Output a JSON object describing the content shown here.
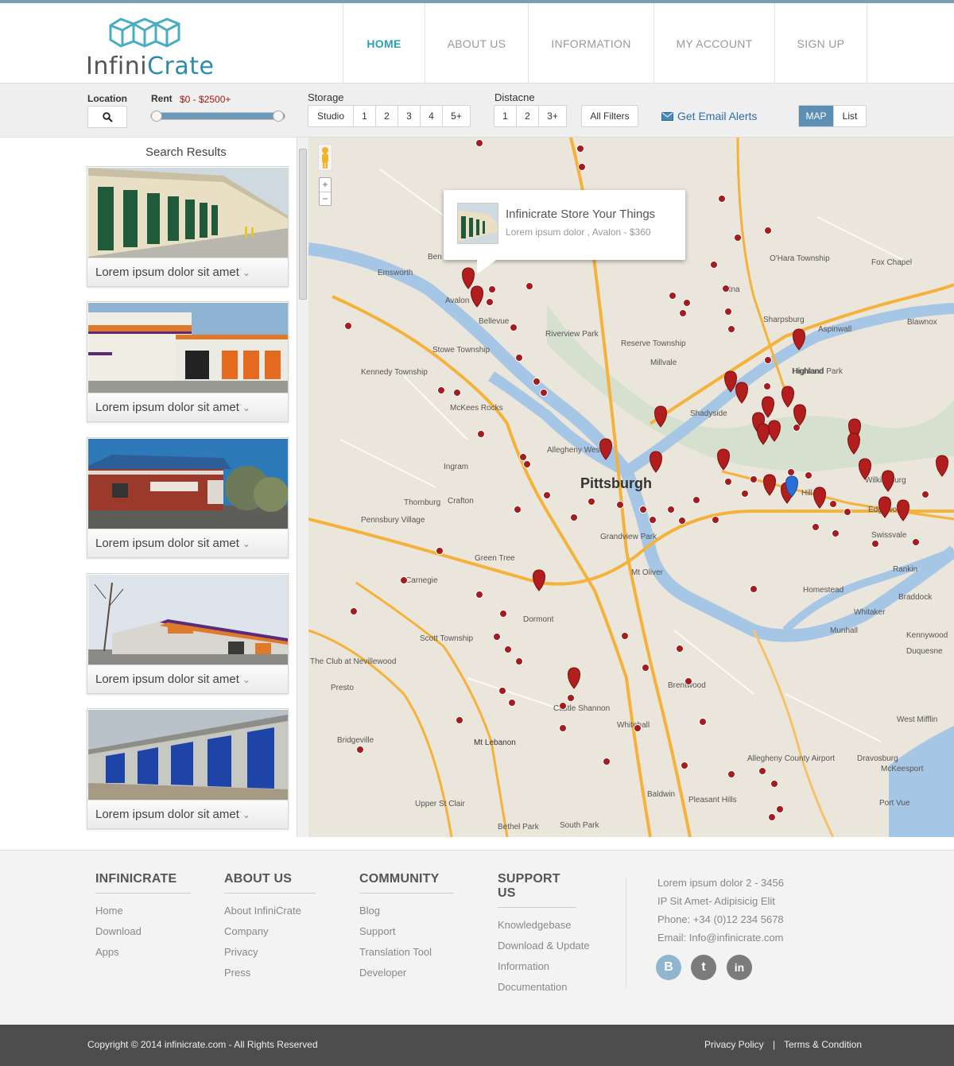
{
  "brand": {
    "name_part1": "Infini",
    "name_part2": "Crate"
  },
  "nav": [
    {
      "label": "HOME",
      "active": true
    },
    {
      "label": "ABOUT US"
    },
    {
      "label": "INFORMATION"
    },
    {
      "label": "MY ACCOUNT"
    },
    {
      "label": "SIGN UP"
    }
  ],
  "filters": {
    "location_label": "Location",
    "rent_label": "Rent",
    "rent_range": "$0  -  $2500+",
    "storage_label": "Storage",
    "storage_options": [
      "Studio",
      "1",
      "2",
      "3",
      "4",
      "5+"
    ],
    "distance_label": "Distacne",
    "distance_options": [
      "1",
      "2",
      "3+"
    ],
    "all_filters": "All Filters",
    "email_alerts": "Get Email Alerts",
    "view_map": "MAP",
    "view_list": "List",
    "search_icon": "search-icon",
    "mail_icon": "mail-icon"
  },
  "results": {
    "heading": "Search Results",
    "items": [
      {
        "caption": "Lorem ipsum dolor sit amet"
      },
      {
        "caption": "Lorem ipsum dolor sit amet"
      },
      {
        "caption": "Lorem ipsum dolor sit amet"
      },
      {
        "caption": "Lorem ipsum dolor sit amet"
      },
      {
        "caption": "Lorem ipsum dolor sit amet"
      }
    ]
  },
  "map": {
    "popup_title": "Infinicrate Store Your Things",
    "popup_subtitle": "Lorem ipsum dolor , Avalon - $360",
    "zoom_in": "+",
    "zoom_out": "−",
    "city_label": "Pittsburgh",
    "labels": [
      "Ben Avon Heights",
      "Emsworth",
      "Avalon",
      "Bellevue",
      "Stowe Township",
      "Kennedy Township",
      "McKees Rocks",
      "Ingram",
      "Crafton",
      "Thornburg",
      "Pennsbury Village",
      "Green Tree",
      "Carnegie",
      "Scott Township",
      "The Club at Nevillewood",
      "Presto",
      "Bridgeville",
      "Upper St Clair",
      "Mt Lebanon",
      "Castle Shannon",
      "Dormont",
      "Mt Oliver",
      "Brentwood",
      "Whitehall",
      "Baldwin",
      "Pleasant Hills",
      "Bethel Park",
      "South Park",
      "Riverview Park",
      "Reserve Township",
      "Millvale",
      "Etna",
      "Sharpsburg",
      "Aspinwall",
      "O'Hara Township",
      "Fox Chapel",
      "Blawnox",
      "Highland Park",
      "Grandview Park",
      "Homestead",
      "Munhall",
      "Whitaker",
      "Braddock",
      "Rankin",
      "Swissvale",
      "Edgewood",
      "Kennywood",
      "Duquesne",
      "West Mifflin",
      "Allegheny County Airport",
      "Dravosburg",
      "McKeesport",
      "Port Vue",
      "Hill",
      "Wilkinsburg",
      "Allegheny West",
      "Highland",
      "Shadyside"
    ]
  },
  "footer": {
    "columns": [
      {
        "title": "INFINICRATE",
        "links": [
          "Home",
          "Download",
          "Apps"
        ]
      },
      {
        "title": "ABOUT US",
        "links": [
          "About InfiniCrate",
          "Company",
          "Privacy",
          "Press"
        ]
      },
      {
        "title": "COMMUNITY",
        "links": [
          "Blog",
          "Support",
          "Translation Tool",
          "Developer"
        ]
      },
      {
        "title": "SUPPORT US",
        "links": [
          "Knowledgebase",
          "Download & Update",
          "Information",
          "Documentation"
        ]
      }
    ],
    "contact": [
      "Lorem ipsum dolor 2 - 3456",
      "IP Sit Amet- Adipisicig Elit",
      "Phone: +34 (0)12 234 5678",
      "Email: Info@infinicrate.com"
    ],
    "social": [
      {
        "icon": "blogger-icon",
        "glyph": "B"
      },
      {
        "icon": "twitter-icon",
        "glyph": "t"
      },
      {
        "icon": "linkedin-icon",
        "glyph": "in"
      }
    ],
    "copyright": "Copyright © 2014 infinicrate.com - All Rights Reserved",
    "privacy": "Privacy Policy",
    "separator": "|",
    "terms": "Terms & Condition"
  }
}
